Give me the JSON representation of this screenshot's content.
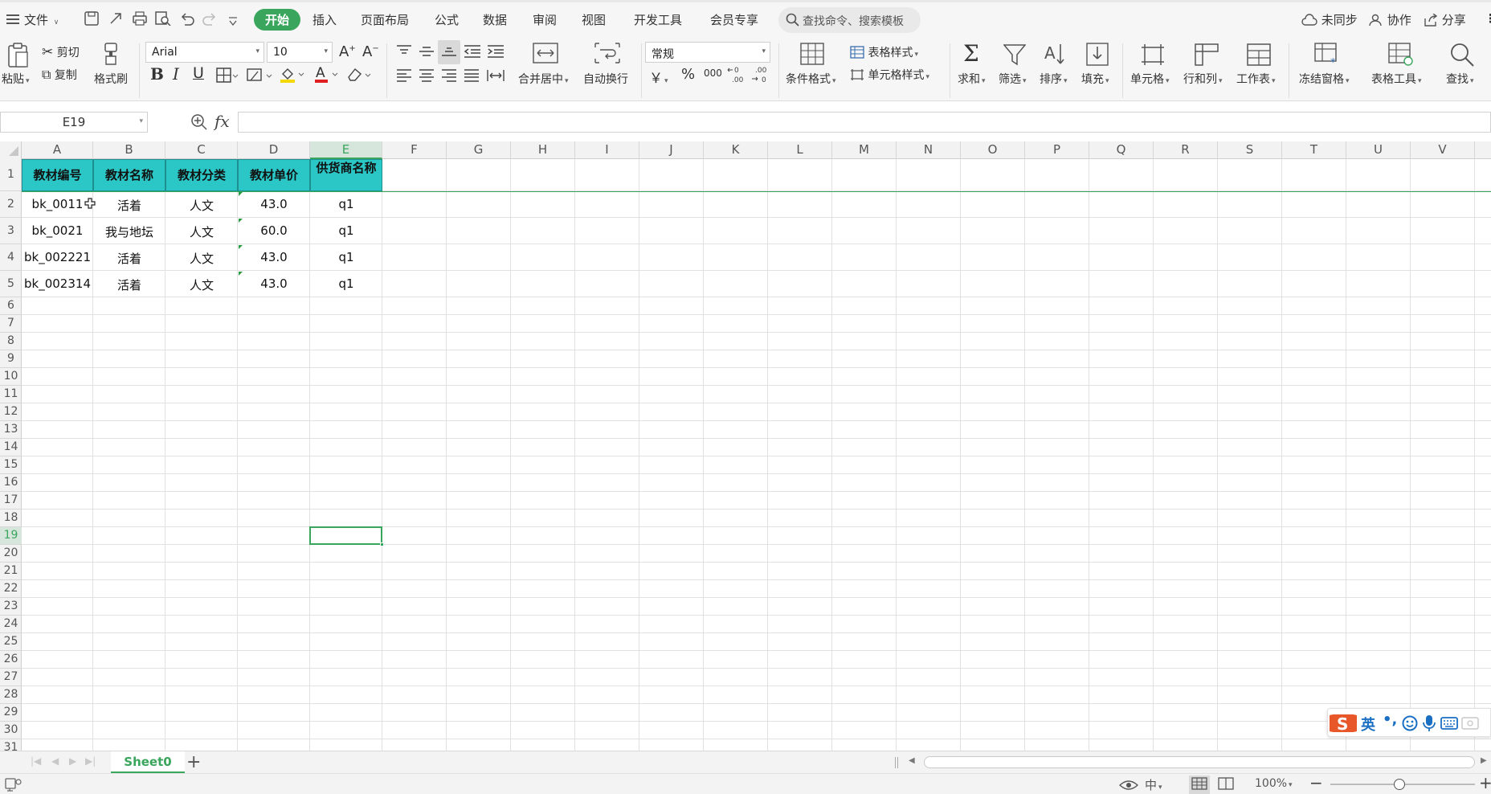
{
  "menubar": {
    "file": "文件",
    "tabs": [
      "开始",
      "插入",
      "页面布局",
      "公式",
      "数据",
      "审阅",
      "视图",
      "开发工具",
      "会员专享"
    ],
    "search_placeholder": "查找命令、搜索模板",
    "sync": "未同步",
    "collab": "协作",
    "share": "分享"
  },
  "ribbon": {
    "paste": "粘贴",
    "cut": "剪切",
    "copy": "复制",
    "format_painter": "格式刷",
    "font": "Arial",
    "font_size": "10",
    "merge_center": "合并居中",
    "wrap": "自动换行",
    "number_format": "常规",
    "currency": "￥",
    "percent": "%",
    "thousands": "000",
    "conditional": "条件格式",
    "table_style": "表格样式",
    "cell_style": "单元格样式",
    "sum": "求和",
    "filter": "筛选",
    "sort": "排序",
    "fill": "填充",
    "cells": "单元格",
    "rowcol": "行和列",
    "sheet": "工作表",
    "freeze": "冻结窗格",
    "table_tools": "表格工具",
    "find": "查找"
  },
  "formula": {
    "namebox": "E19",
    "fx": "fx",
    "value": ""
  },
  "grid": {
    "columns": [
      "A",
      "B",
      "C",
      "D",
      "E",
      "F",
      "G",
      "H",
      "I",
      "J",
      "K",
      "L",
      "M",
      "N",
      "O",
      "P",
      "Q",
      "R",
      "S",
      "T",
      "U",
      "V"
    ],
    "selected_column": "E",
    "selected_row": 19,
    "headers": [
      "教材编号",
      "教材名称",
      "教材分类",
      "教材单价",
      "供货商名称"
    ],
    "rows": [
      [
        "bk_0011",
        "活着",
        "人文",
        "43.0",
        "q1"
      ],
      [
        "bk_0021",
        "我与地坛",
        "人文",
        "60.0",
        "q1"
      ],
      [
        "bk_002221",
        "活着",
        "人文",
        "43.0",
        "q1"
      ],
      [
        "bk_002314",
        "活着",
        "人文",
        "43.0",
        "q1"
      ]
    ]
  },
  "ime": {
    "mode": "英"
  },
  "sheets": {
    "active": "Sheet0"
  },
  "status": {
    "zoom": "100%"
  },
  "colors": {
    "accent": "#3aa55c",
    "header_fill": "#2bc6c6"
  }
}
